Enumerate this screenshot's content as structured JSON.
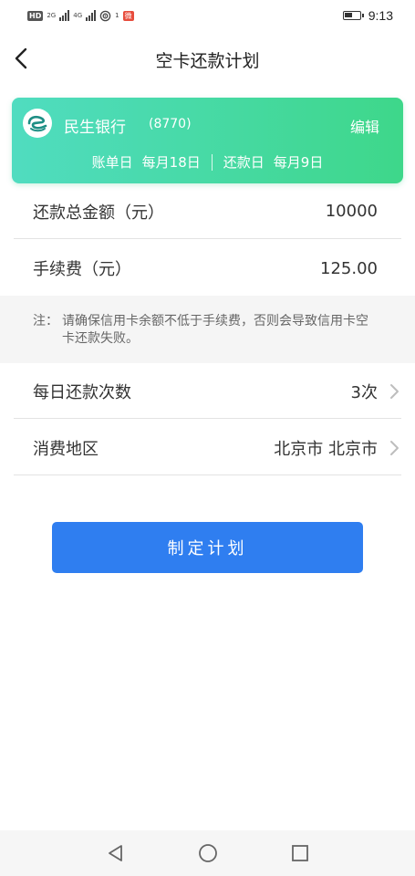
{
  "status_bar": {
    "left_text": "HD",
    "signal_1_label": "2G",
    "signal_2_label": "4G",
    "wifi_badge": "1",
    "notification_badge": "微",
    "battery_level_percent": 50,
    "time": "9:13"
  },
  "header": {
    "title": "空卡还款计划",
    "back_icon": "chevron-left-icon"
  },
  "card": {
    "bank_name": "民生银行",
    "card_tail": "(8770)",
    "edit_label": "编辑",
    "bill_day_label": "账单日",
    "bill_day_value": "每月18日",
    "repay_day_label": "还款日",
    "repay_day_value": "每月9日",
    "gradient_start": "#50dcc0",
    "gradient_end": "#3ed78a",
    "logo_color": "#1d8e84"
  },
  "rows": {
    "total_amount_label": "还款总金额（元）",
    "total_amount_value": "10000",
    "fee_label": "手续费（元）",
    "fee_value": "125.00",
    "daily_times_label": "每日还款次数",
    "daily_times_value": "3次",
    "region_label": "消费地区",
    "region_value": "北京市 北京市"
  },
  "note": {
    "prefix": "注：",
    "text": "请确保信用卡余额不低于手续费，否则会导致信用卡空卡还款失败。"
  },
  "actions": {
    "submit_label": "制定计划",
    "button_color": "#2f7ef0"
  },
  "nav_bar": {
    "back_icon": "triangle-back-icon",
    "home_icon": "circle-home-icon",
    "recent_icon": "square-recent-icon"
  }
}
